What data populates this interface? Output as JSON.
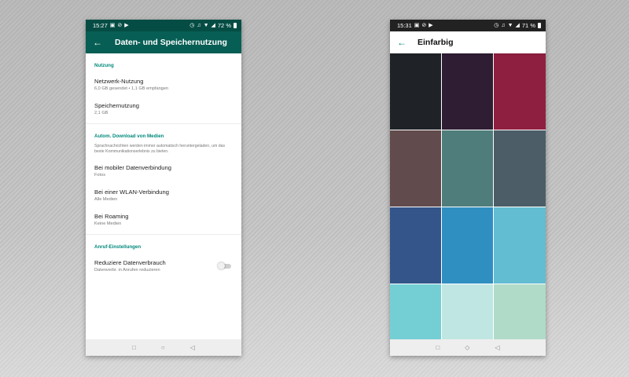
{
  "left_phone": {
    "status": {
      "time": "15:27",
      "battery": "72 %"
    },
    "title": "Daten- und Speichernutzung",
    "sections": [
      {
        "header": "Nutzung",
        "items": [
          {
            "title": "Netzwerk-Nutzung",
            "subtitle": "6,0 GB gesendet • 1,1 GB empfangen"
          },
          {
            "title": "Speichernutzung",
            "subtitle": "2,1 GB"
          }
        ]
      },
      {
        "header": "Autom. Download von Medien",
        "note": "Sprachnachrichten werden immer automatisch heruntergeladen, um das beste Kommunikationserlebnis zu bieten.",
        "items": [
          {
            "title": "Bei mobiler Datenverbindung",
            "subtitle": "Fotos"
          },
          {
            "title": "Bei einer WLAN-Verbindung",
            "subtitle": "Alle Medien"
          },
          {
            "title": "Bei Roaming",
            "subtitle": "Keine Medien"
          }
        ]
      },
      {
        "header": "Anruf-Einstellungen",
        "items": [
          {
            "title": "Reduziere Datenverbrauch",
            "subtitle": "Datenverbr. in Anrufen reduzieren",
            "toggle_on": false
          }
        ]
      }
    ],
    "colors": {
      "status_bar": "#054d44",
      "app_bar": "#075e54",
      "accent": "#00897b"
    }
  },
  "right_phone": {
    "status": {
      "time": "15:31",
      "battery": "71 %"
    },
    "title": "Einfarbig",
    "swatches": [
      "#1f2327",
      "#2e1d33",
      "#8f1f40",
      "#624b4d",
      "#4e7d7b",
      "#4c5d68",
      "#33558a",
      "#2f8fc1",
      "#62bdd2",
      "#74cfd5",
      "#bfe6e2",
      "#b0dbc9"
    ]
  },
  "icons": {
    "back": "arrow-left-icon",
    "nav": [
      "square-icon",
      "circle-icon",
      "triangle-back-icon"
    ]
  }
}
